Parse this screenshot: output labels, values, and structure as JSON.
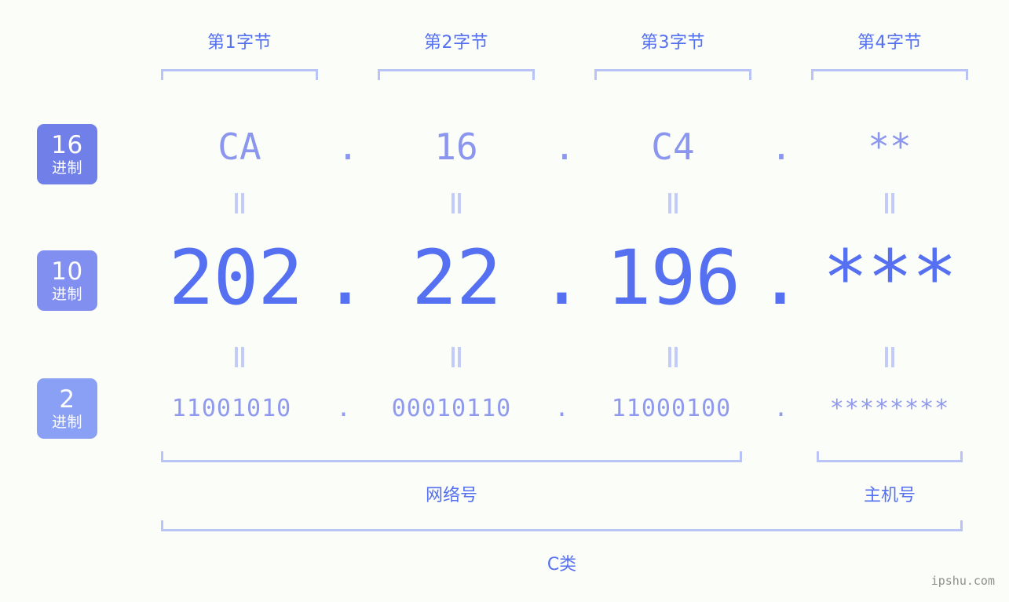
{
  "byte_headers": [
    {
      "label": "第1字节"
    },
    {
      "label": "第2字节"
    },
    {
      "label": "第3字节"
    },
    {
      "label": "第4字节"
    }
  ],
  "bases": [
    {
      "num": "16",
      "suffix": "进制",
      "color": "#7180e8"
    },
    {
      "num": "10",
      "suffix": "进制",
      "color": "#818ff0"
    },
    {
      "num": "2",
      "suffix": "进制",
      "color": "#8aa0f5"
    }
  ],
  "rows": {
    "hex": {
      "values": [
        "CA",
        "16",
        "C4",
        "**"
      ],
      "separators": [
        ".",
        ".",
        "."
      ]
    },
    "dec": {
      "values": [
        "202",
        "22",
        "196",
        "***"
      ],
      "separators": [
        ".",
        ".",
        "."
      ]
    },
    "bin": {
      "values": [
        "11001010",
        "00010110",
        "11000100",
        "********"
      ],
      "separators": [
        ".",
        ".",
        "."
      ]
    }
  },
  "sections": [
    {
      "label": "网络号"
    },
    {
      "label": "主机号"
    }
  ],
  "class_label": "C类",
  "watermark": "ipshu.com",
  "colors": {
    "background": "#fbfdf8",
    "bracket": "#b9c3f5",
    "equals": "#c3cbf8",
    "hex_text": "#8b96ee",
    "dec_text": "#5570f0",
    "bin_text": "#8f9aef",
    "label_text": "#5570f0",
    "watermark_text": "#8f8f8f"
  }
}
